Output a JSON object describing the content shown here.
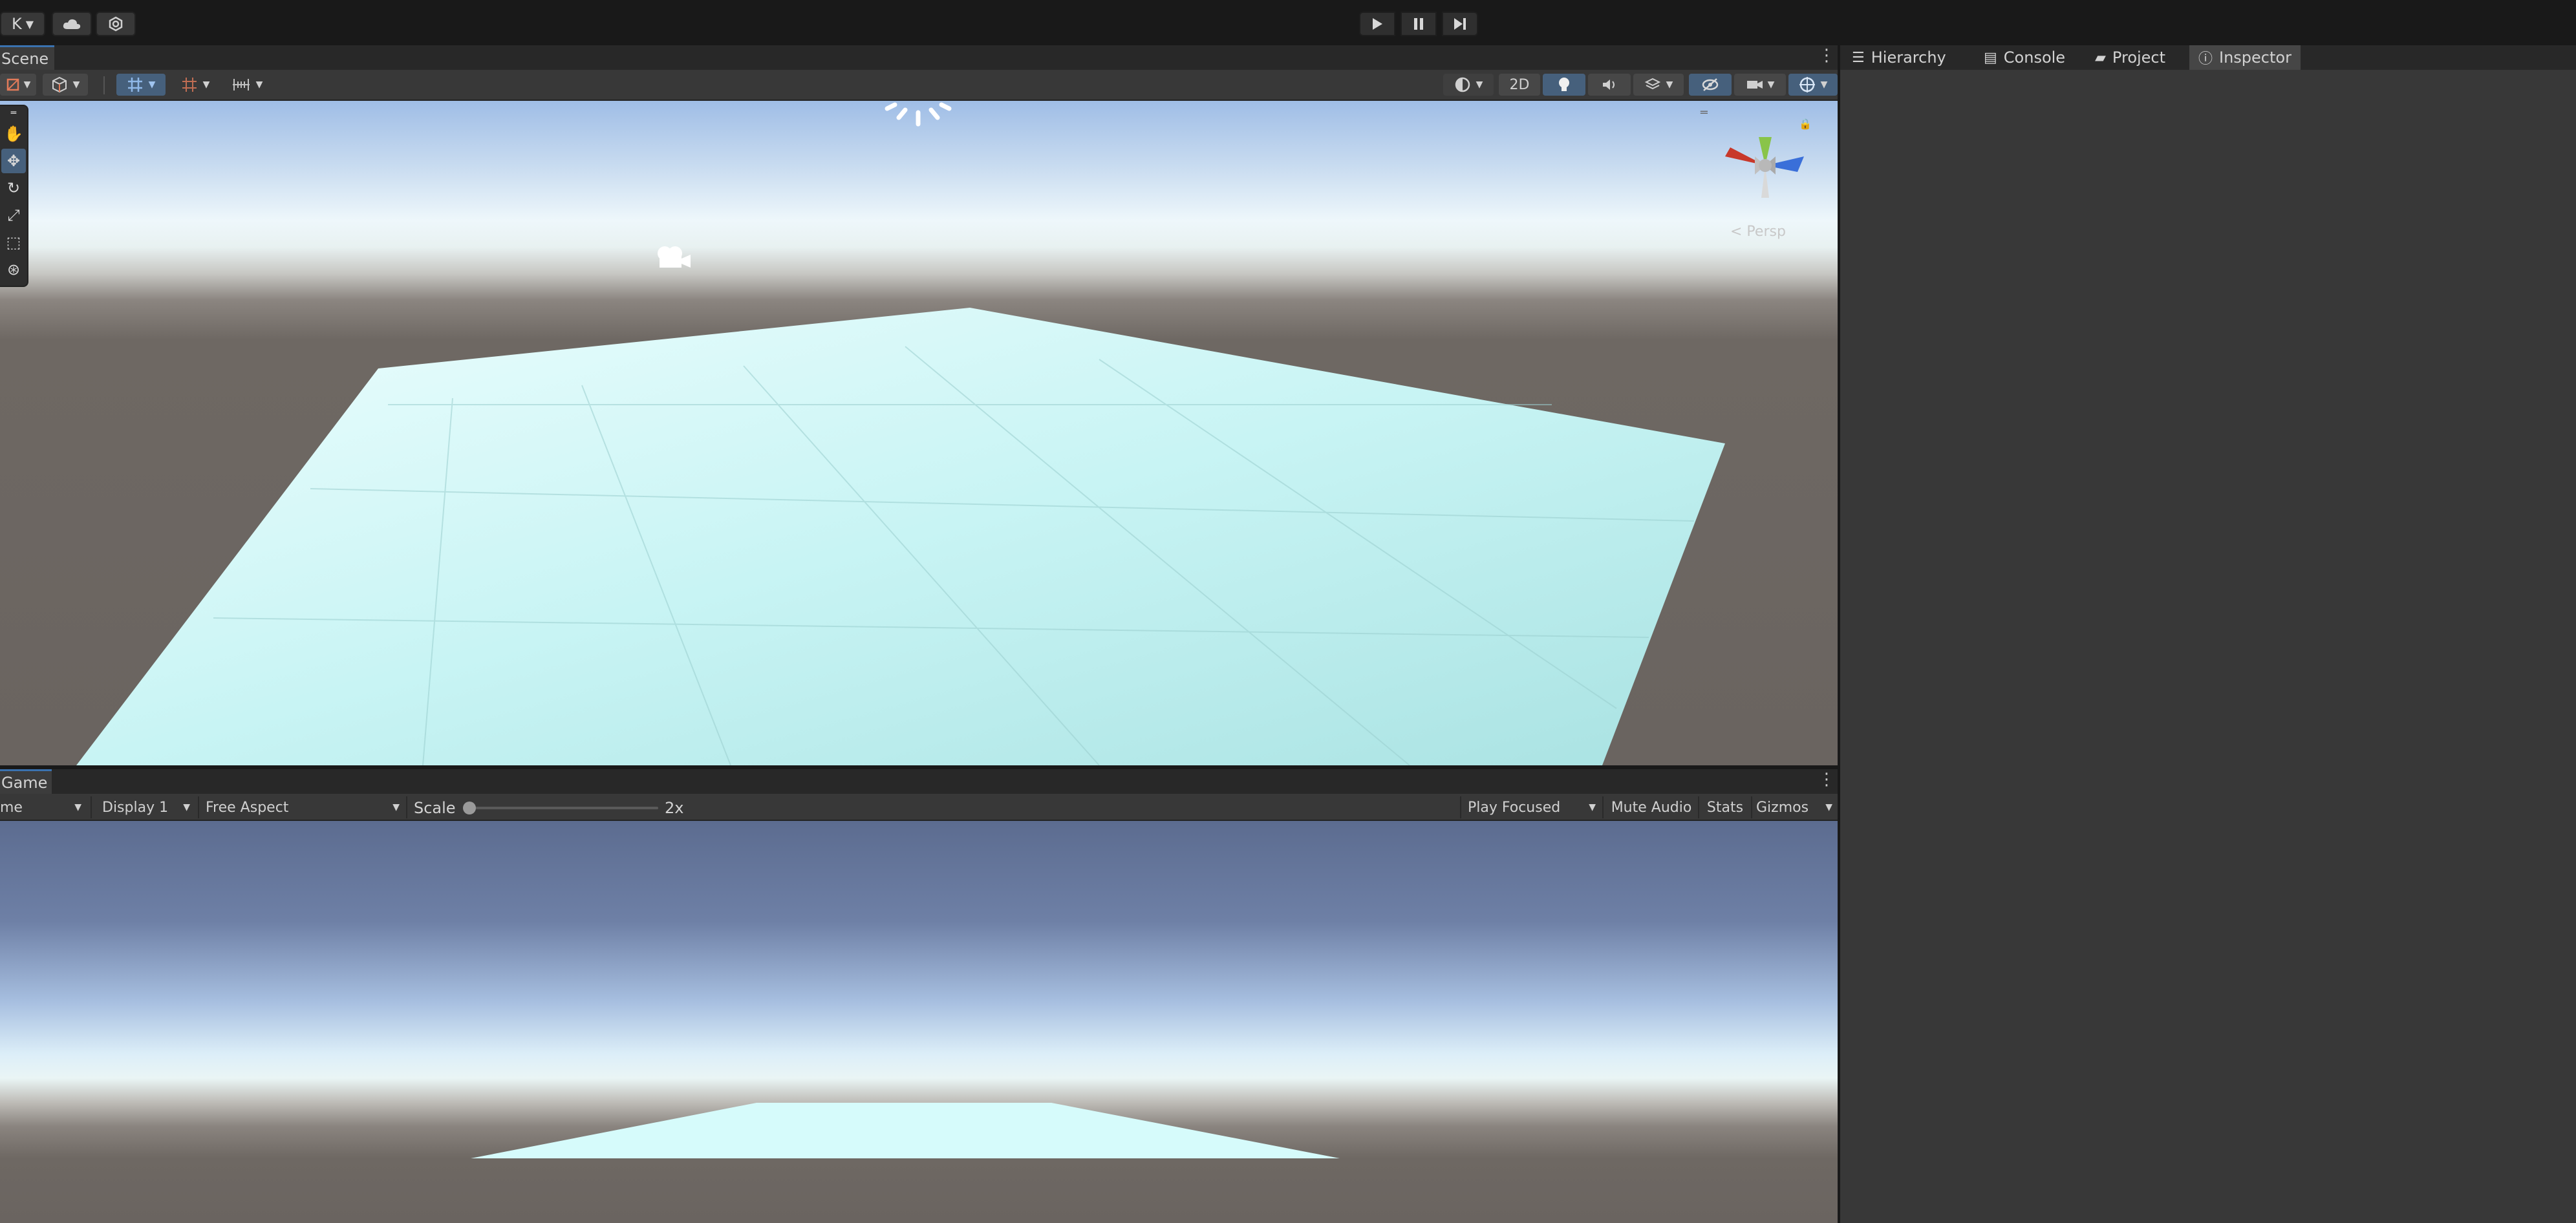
{
  "topbar": {
    "account_label": "K",
    "cloud_icon": "cloud-icon",
    "services_icon": "services-icon",
    "play_icon": "play-icon",
    "pause_icon": "pause-icon",
    "step_icon": "step-icon"
  },
  "scene_panel": {
    "tab_label": "Scene",
    "toolbar": {
      "two_d_label": "2D"
    },
    "orientation_label": "< Persp"
  },
  "game_panel": {
    "tab_label": "Game",
    "mode_label": "me",
    "display_label": "Display 1",
    "aspect_label": "Free Aspect",
    "scale_label": "Scale",
    "scale_value": "2x",
    "play_focused_label": "Play Focused",
    "mute_audio_label": "Mute Audio",
    "stats_label": "Stats",
    "gizmos_label": "Gizmos"
  },
  "right_dock": {
    "tabs": [
      {
        "label": "Hierarchy",
        "icon": "hierarchy-icon"
      },
      {
        "label": "Console",
        "icon": "console-icon"
      },
      {
        "label": "Project",
        "icon": "folder-icon"
      },
      {
        "label": "Inspector",
        "icon": "info-icon"
      }
    ],
    "active_tab": "Inspector"
  },
  "colors": {
    "accent": "#3a72b0",
    "panel_bg": "#383838",
    "dark_bg": "#191919",
    "tab_strip": "#282828",
    "floor": "#c2f6f6"
  }
}
